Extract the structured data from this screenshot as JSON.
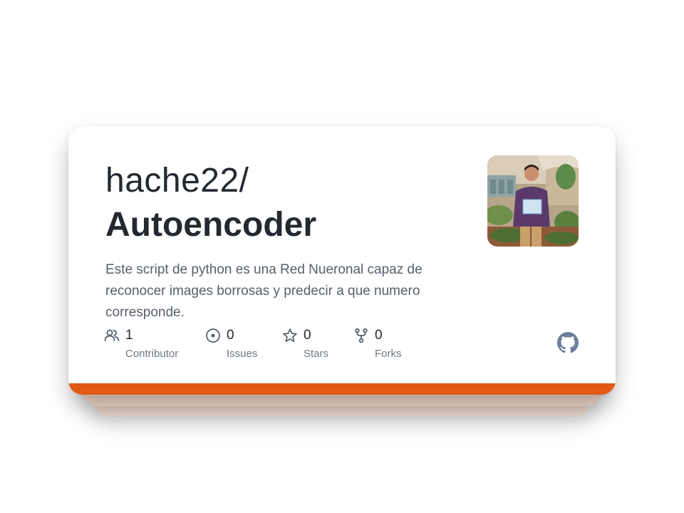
{
  "repo": {
    "owner": "hache22/",
    "name": "Autoencoder",
    "description": "Este script de python es una Red Nueronal capaz de reconocer images borrosas y predecir a que numero corresponde."
  },
  "stats": [
    {
      "icon": "contributors-icon",
      "count": "1",
      "label": "Contributor"
    },
    {
      "icon": "issues-icon",
      "count": "0",
      "label": "Issues"
    },
    {
      "icon": "star-icon",
      "count": "0",
      "label": "Stars"
    },
    {
      "icon": "fork-icon",
      "count": "0",
      "label": "Forks"
    }
  ],
  "icons": {
    "brand": "github-icon",
    "avatar": "owner-avatar"
  },
  "colors": {
    "accent": "#e05a14",
    "text_primary": "#24292f",
    "text_secondary": "#57606a",
    "icon": "#57606a",
    "github_mark": "#6e7f9a"
  }
}
